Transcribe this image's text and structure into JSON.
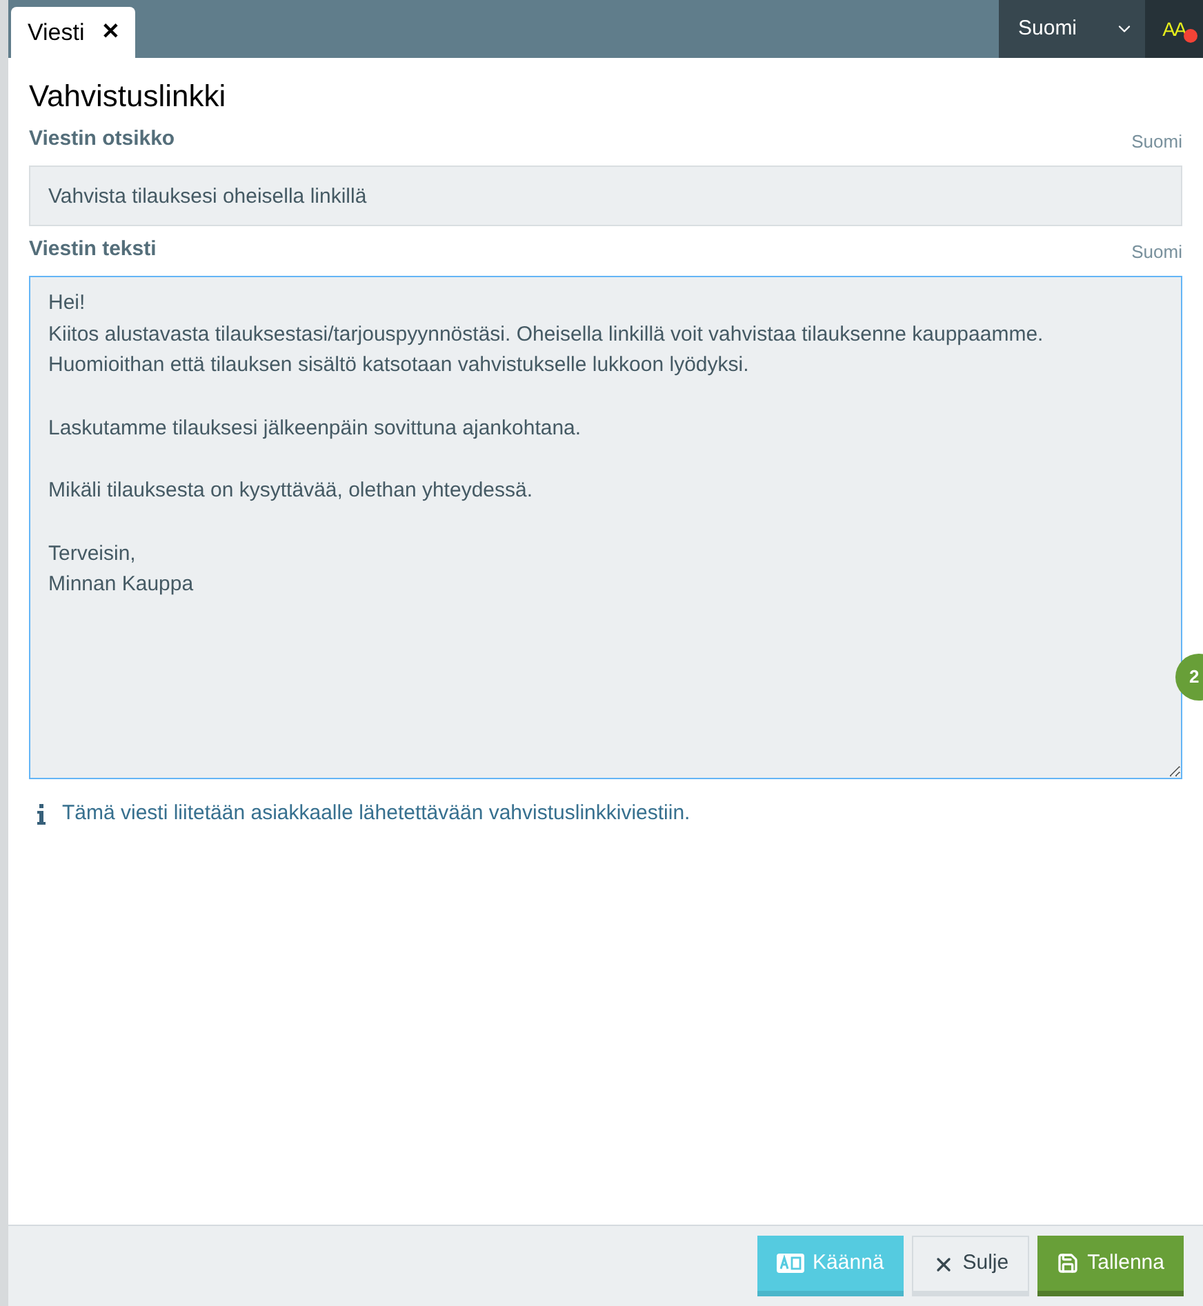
{
  "tab": {
    "label": "Viesti",
    "close": "✕"
  },
  "language_menu": {
    "value": "Suomi"
  },
  "font_toggle": {
    "label": "AA",
    "alert": true
  },
  "title": "Vahvistuslinkki",
  "fields": [
    {
      "label": "Viestin otsikko",
      "language": "Suomi",
      "kind": "input",
      "value": "Vahvista tilauksesi oheisella linkillä",
      "focused": false
    },
    {
      "label": "Viestin teksti",
      "language": "Suomi",
      "kind": "textarea",
      "value": "Hei!\nKiitos alustavasta tilauksestasi/tarjouspyynnöstäsi. Oheisella linkillä voit vahvistaa tilauksenne kauppaamme.\nHuomioithan että tilauksen sisältö katsotaan vahvistukselle lukkoon lyödyksi.\n\nLaskutamme tilauksesi jälkeenpäin sovittuna ajankohtana.\n\nMikäli tilauksesta on kysyttävää, olethan yhteydessä.\n\nTerveisin,\nMinnan Kauppa",
      "focused": true
    }
  ],
  "info": "Tämä viesti liitetään asiakkaalle lähetettävään vahvistuslinkkiviestiin.",
  "badge": "2",
  "buttons": [
    {
      "label": "Käännä",
      "kind": "translate"
    },
    {
      "label": "Sulje",
      "kind": "close"
    },
    {
      "label": "Tallenna",
      "kind": "save"
    }
  ]
}
